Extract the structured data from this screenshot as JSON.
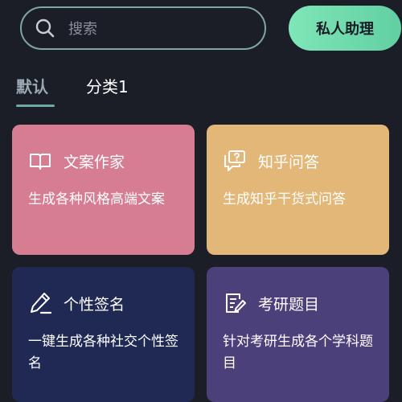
{
  "search": {
    "placeholder": "搜索"
  },
  "assistant_button": {
    "label": "私人助理"
  },
  "tabs": [
    {
      "label": "默认",
      "active": true
    },
    {
      "label": "分类1",
      "active": false
    }
  ],
  "cards": [
    {
      "title": "文案作家",
      "description": "生成各种风格高端文案",
      "icon": "book-icon",
      "color": "#d67d92"
    },
    {
      "title": "知乎问答",
      "description": "生成知乎干货式问答",
      "icon": "chat-question-icon",
      "color": "#e2b778"
    },
    {
      "title": "个性签名",
      "description": "一键生成各种社交个性签名",
      "icon": "pen-icon",
      "color": "#1f2954"
    },
    {
      "title": "考研题目",
      "description": "针对考研生成各个学科题目",
      "icon": "edit-document-icon",
      "color": "#4c407a"
    }
  ]
}
